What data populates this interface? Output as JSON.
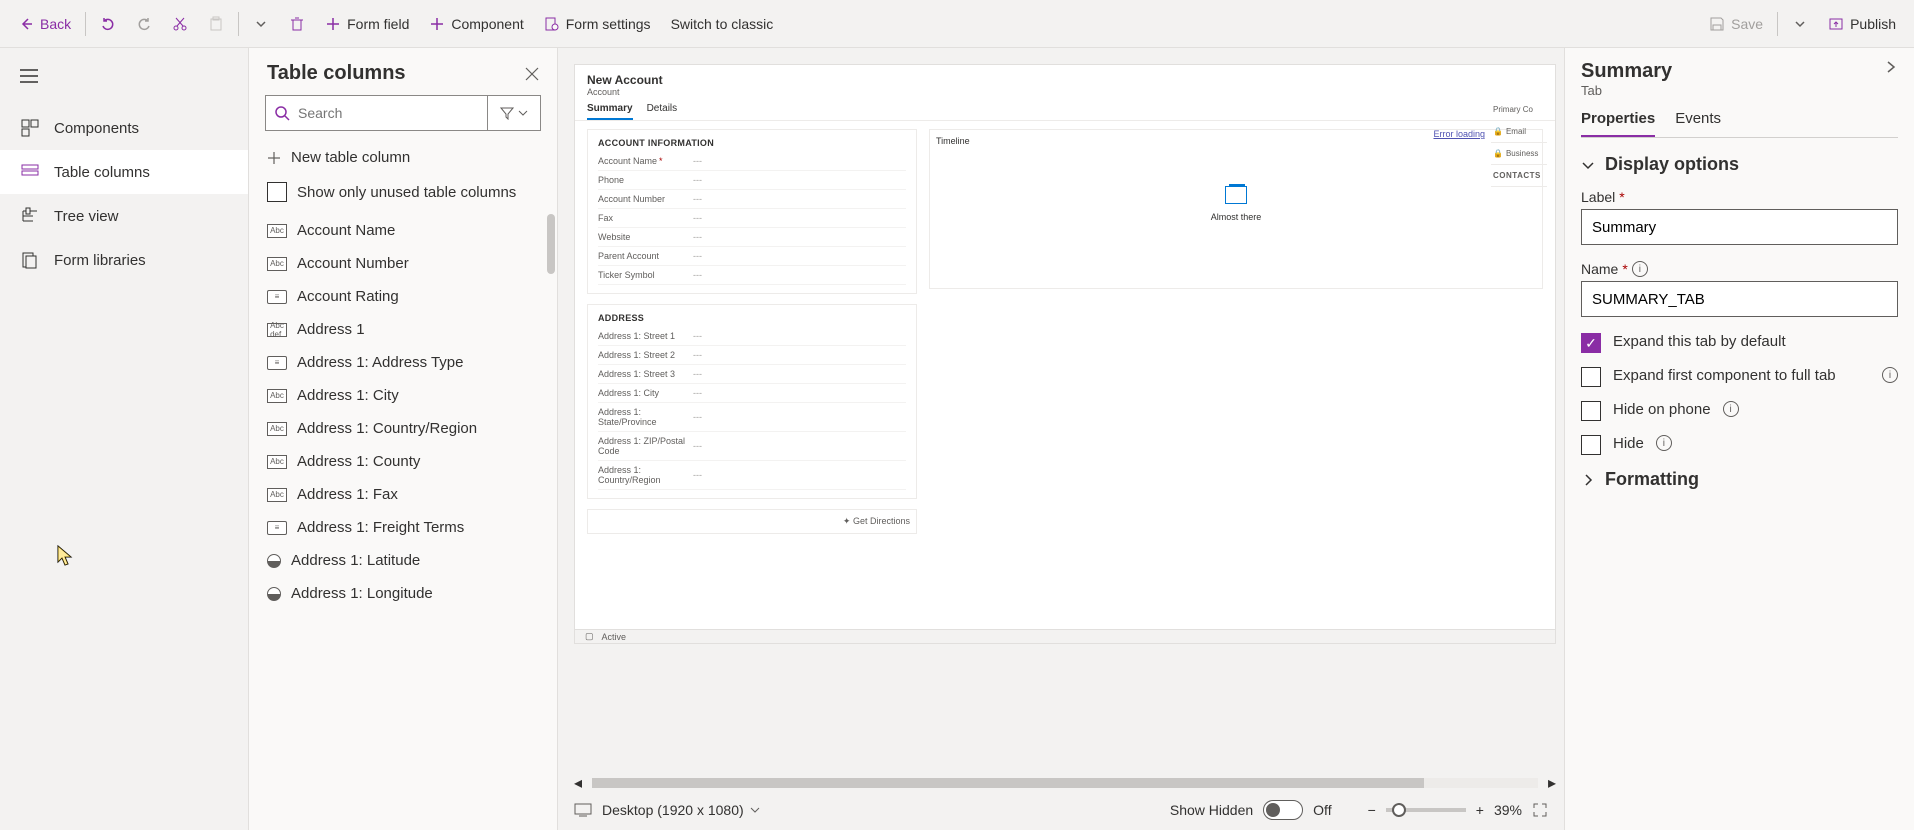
{
  "toolbar": {
    "back": "Back",
    "form_field": "Form field",
    "component": "Component",
    "form_settings": "Form settings",
    "switch_classic": "Switch to classic",
    "save": "Save",
    "publish": "Publish"
  },
  "rail": {
    "components": "Components",
    "table_columns": "Table columns",
    "tree_view": "Tree view",
    "form_libraries": "Form libraries"
  },
  "col_panel": {
    "title": "Table columns",
    "search_placeholder": "Search",
    "new_column": "New table column",
    "show_unused": "Show only unused table columns",
    "items": [
      {
        "icon": "Abc",
        "label": "Account Name"
      },
      {
        "icon": "Abc",
        "label": "Account Number"
      },
      {
        "icon": "opt",
        "label": "Account Rating"
      },
      {
        "icon": "Abc\ndef",
        "label": "Address 1"
      },
      {
        "icon": "opt",
        "label": "Address 1: Address Type"
      },
      {
        "icon": "Abc",
        "label": "Address 1: City"
      },
      {
        "icon": "Abc",
        "label": "Address 1: Country/Region"
      },
      {
        "icon": "Abc",
        "label": "Address 1: County"
      },
      {
        "icon": "Abc",
        "label": "Address 1: Fax"
      },
      {
        "icon": "opt",
        "label": "Address 1: Freight Terms"
      },
      {
        "icon": "geo",
        "label": "Address 1: Latitude"
      },
      {
        "icon": "geo",
        "label": "Address 1: Longitude"
      }
    ]
  },
  "preview": {
    "title": "New Account",
    "subtitle": "Account",
    "tabs": [
      "Summary",
      "Details"
    ],
    "error_loading": "Error loading",
    "sections": {
      "account_info": {
        "title": "ACCOUNT INFORMATION",
        "fields": [
          {
            "label": "Account Name",
            "req": true,
            "val": "---"
          },
          {
            "label": "Phone",
            "val": "---"
          },
          {
            "label": "Account Number",
            "val": "---"
          },
          {
            "label": "Fax",
            "val": "---"
          },
          {
            "label": "Website",
            "val": "---"
          },
          {
            "label": "Parent Account",
            "val": "---"
          },
          {
            "label": "Ticker Symbol",
            "val": "---"
          }
        ]
      },
      "address": {
        "title": "ADDRESS",
        "fields": [
          {
            "label": "Address 1: Street 1",
            "val": "---"
          },
          {
            "label": "Address 1: Street 2",
            "val": "---"
          },
          {
            "label": "Address 1: Street 3",
            "val": "---"
          },
          {
            "label": "Address 1: City",
            "val": "---"
          },
          {
            "label": "Address 1: State/Province",
            "val": "---"
          },
          {
            "label": "Address 1: ZIP/Postal Code",
            "val": "---"
          },
          {
            "label": "Address 1: Country/Region",
            "val": "---"
          }
        ]
      }
    },
    "timeline_title": "Timeline",
    "timeline_msg": "Almost there",
    "get_directions": "Get Directions",
    "right_strip": {
      "primary": "Primary Co",
      "email": "Email",
      "business": "Business",
      "contacts": "CONTACTS"
    },
    "status": "Active"
  },
  "canvas_footer": {
    "device": "Desktop (1920 x 1080)",
    "show_hidden": "Show Hidden",
    "toggle_state": "Off",
    "zoom": "39%"
  },
  "props": {
    "title": "Summary",
    "subtitle": "Tab",
    "tabs": [
      "Properties",
      "Events"
    ],
    "display_options": "Display options",
    "label_field": "Label",
    "label_value": "Summary",
    "name_field": "Name",
    "name_value": "SUMMARY_TAB",
    "expand_default": "Expand this tab by default",
    "expand_first": "Expand first component to full tab",
    "hide_phone": "Hide on phone",
    "hide": "Hide",
    "formatting": "Formatting"
  }
}
